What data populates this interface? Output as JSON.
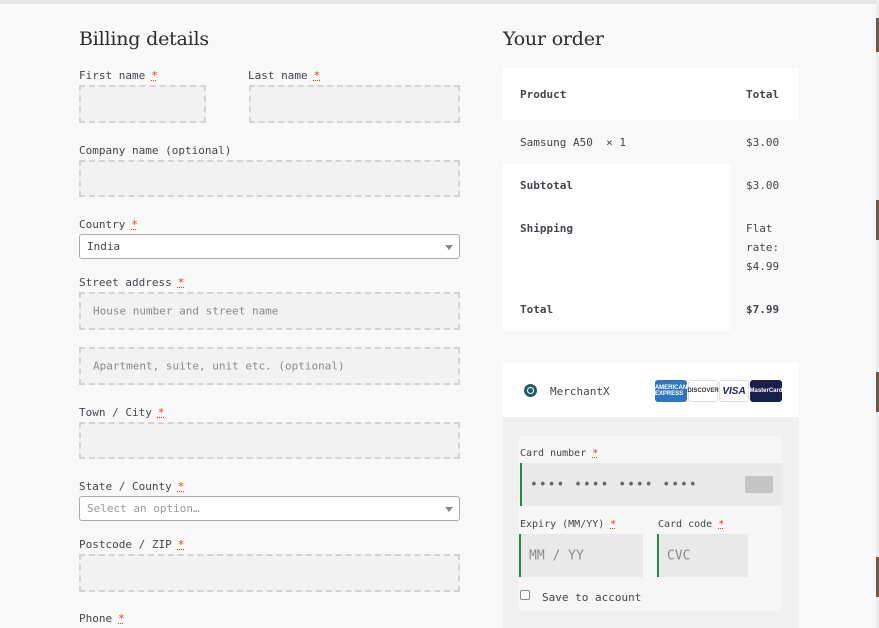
{
  "billing": {
    "title": "Billing details",
    "first_name_label": "First name",
    "last_name_label": "Last name",
    "company_label": "Company name (optional)",
    "country_label": "Country",
    "country_value": "India",
    "street_label": "Street address",
    "street_placeholder": "House number and street name",
    "apartment_placeholder": "Apartment, suite, unit etc. (optional)",
    "town_label": "Town / City",
    "state_label": "State / County",
    "state_placeholder": "Select an option…",
    "postcode_label": "Postcode / ZIP",
    "phone_label": "Phone",
    "required_mark": "*"
  },
  "order": {
    "title": "Your order",
    "header_product": "Product",
    "header_total": "Total",
    "item_name": "Samsung A50",
    "item_qty": "× 1",
    "item_total": "$3.00",
    "subtotal_label": "Subtotal",
    "subtotal_value": "$3.00",
    "shipping_label": "Shipping",
    "shipping_value_1": "Flat",
    "shipping_value_2": "rate:",
    "shipping_value_3": "$4.99",
    "total_label": "Total",
    "total_value": "$7.99"
  },
  "payment": {
    "method_label": "MerchantX",
    "card_brands": [
      "AMERICAN EXPRESS",
      "DISCOVER",
      "VISA",
      "MasterCard"
    ],
    "card_number_label": "Card number",
    "card_number_placeholder": "•••• •••• •••• ••••",
    "expiry_label": "Expiry (MM/YY)",
    "expiry_placeholder": "MM / YY",
    "card_code_label": "Card code",
    "card_code_placeholder": "CVC",
    "save_label": "Save to account",
    "accent_color": "#1c5f63",
    "field_accent": "#1e8a4f",
    "required_color": "#e2401c"
  }
}
